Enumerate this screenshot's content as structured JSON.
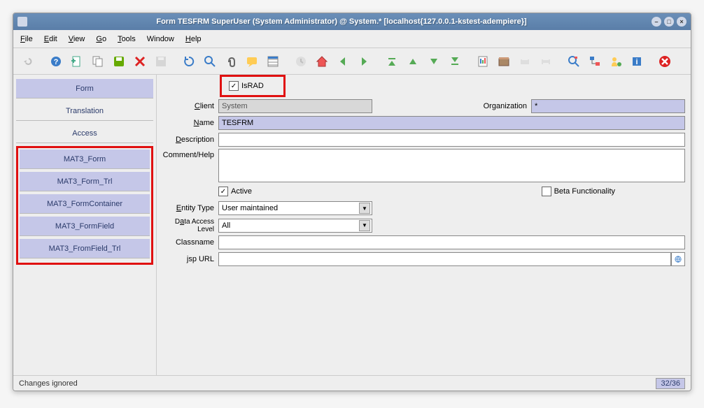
{
  "window": {
    "title": "Form  TESFRM  SuperUser (System Administrator) @ System.* [localhost{127.0.0.1-kstest-adempiere}]"
  },
  "menubar": {
    "file": "File",
    "edit": "Edit",
    "view": "View",
    "go_": "Go",
    "tools": "Tools",
    "window": "Window",
    "help": "Help"
  },
  "sidebar": {
    "form": "Form",
    "translation": "Translation",
    "access": "Access",
    "items": [
      {
        "label": "MAT3_Form"
      },
      {
        "label": "MAT3_Form_Trl"
      },
      {
        "label": "MAT3_FormContainer"
      },
      {
        "label": "MAT3_FormField"
      },
      {
        "label": "MAT3_FromField_Trl"
      }
    ]
  },
  "form": {
    "israd_label": "IsRAD",
    "israd_checked": true,
    "client_label": "Client",
    "client_value": "System",
    "org_label": "Organization",
    "org_value": "*",
    "name_label": "Name",
    "name_value": "TESFRM",
    "desc_label": "Description",
    "desc_value": "",
    "comment_label": "Comment/Help",
    "comment_value": "",
    "active_label": "Active",
    "active_checked": true,
    "beta_label": "Beta Functionality",
    "beta_checked": false,
    "entity_label": "Entity Type",
    "entity_value": "User maintained",
    "dal_label": "Data Access Level",
    "dal_value": "All",
    "classname_label": "Classname",
    "classname_value": "",
    "jsp_label": "jsp URL",
    "jsp_value": ""
  },
  "status": {
    "left": "Changes ignored",
    "right": "32/36"
  }
}
